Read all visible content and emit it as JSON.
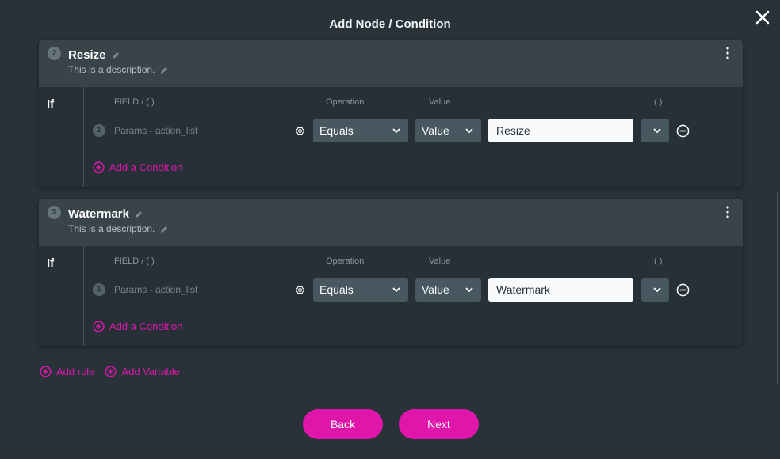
{
  "modal": {
    "title": "Add Node / Condition"
  },
  "columns": {
    "field": "FIELD / ( )",
    "operation": "Operation",
    "value": "Value",
    "paren": "( )"
  },
  "if_label": "If",
  "rules": [
    {
      "number": "2",
      "name": "Resize",
      "description": "This is a description.",
      "conditions": [
        {
          "number": "1",
          "field": "Params - action_list",
          "operation": "Equals",
          "value_type": "Value",
          "value": "Resize",
          "paren": ""
        }
      ],
      "add_condition_label": "Add a Condition"
    },
    {
      "number": "3",
      "name": "Watermark",
      "description": "This is a description.",
      "conditions": [
        {
          "number": "1",
          "field": "Params - action_list",
          "operation": "Equals",
          "value_type": "Value",
          "value": "Watermark",
          "paren": ""
        }
      ],
      "add_condition_label": "Add a Condition"
    }
  ],
  "footer": {
    "add_rule": "Add rule",
    "add_variable": "Add Variable"
  },
  "buttons": {
    "back": "Back",
    "next": "Next"
  },
  "colors": {
    "accent": "#e016ab",
    "background": "#283238",
    "header": "#384449"
  }
}
